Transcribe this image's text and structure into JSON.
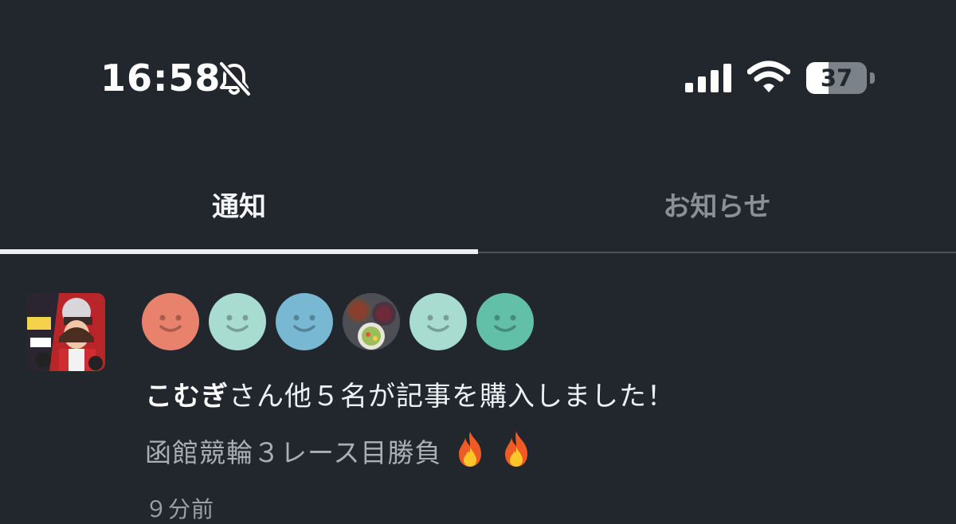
{
  "status_bar": {
    "time": "16:58",
    "battery_level": "37",
    "battery_fraction": 0.37,
    "icons": [
      "bell-muted-icon",
      "signal-icon",
      "wifi-icon",
      "battery-icon"
    ]
  },
  "tabs": [
    {
      "label": "通知",
      "active": true
    },
    {
      "label": "お知らせ",
      "active": false
    }
  ],
  "notification": {
    "buyer_name": "こむぎ",
    "message_rest": "さん他５名が記事を購入しました！",
    "article_title": "函館競輪３レース目勝負",
    "emoji": "🔥",
    "time_ago": "９分前",
    "avatars": [
      {
        "type": "default-smile-icon",
        "color": "#e8826c"
      },
      {
        "type": "default-smile-icon",
        "color": "#a8dcd0"
      },
      {
        "type": "default-smile-icon",
        "color": "#78b8d2"
      },
      {
        "type": "photo-food-avatar",
        "color": "#4d4f55"
      },
      {
        "type": "default-smile-icon",
        "color": "#a8dcd0"
      },
      {
        "type": "default-smile-icon",
        "color": "#62bfa8"
      }
    ]
  },
  "colors": {
    "background": "#22272e",
    "tab_active_text": "#f3f5f7",
    "tab_inactive_text": "#8a9097",
    "secondary_text": "#a9afb6"
  }
}
